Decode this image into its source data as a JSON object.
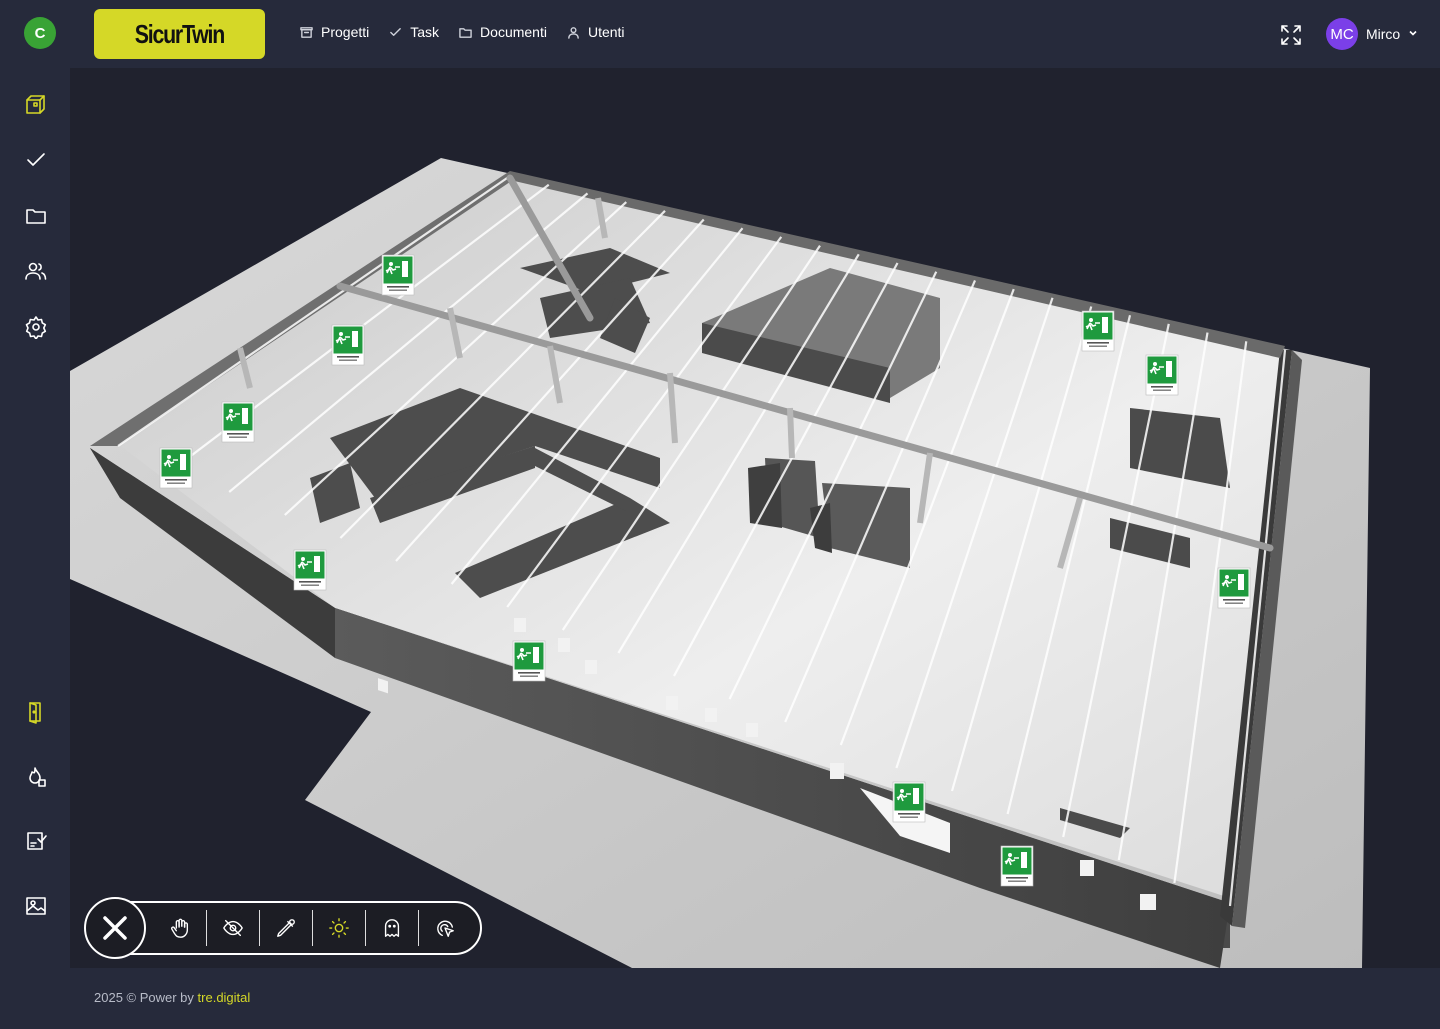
{
  "app": {
    "brand_initial": "C",
    "logo_text": "SicurTwin"
  },
  "nav": {
    "items": [
      {
        "label": "Progetti",
        "icon": "box-icon"
      },
      {
        "label": "Task",
        "icon": "check-icon"
      },
      {
        "label": "Documenti",
        "icon": "folder-icon"
      },
      {
        "label": "Utenti",
        "icon": "user-icon"
      }
    ]
  },
  "user": {
    "initials": "MC",
    "name": "Mirco"
  },
  "sidebar": {
    "icons": [
      "cube-icon",
      "check-icon",
      "folder-icon",
      "users-icon",
      "settings-icon",
      "emergency-door-icon",
      "fire-icon",
      "checklist-icon",
      "image-icon"
    ]
  },
  "viewer": {
    "toolbar": [
      "close-icon",
      "hand-pan-icon",
      "hide-icon",
      "measure-icon",
      "light-icon",
      "ghost-icon",
      "select-icon"
    ]
  },
  "footer": {
    "text": "2025 © Power by ",
    "link": "tre.digital"
  },
  "colors": {
    "accent": "#d5d827",
    "background": "#262a3b",
    "avatar": "#7b3fe8",
    "brand_dot": "#39a335",
    "exit_sign": "#1f9a3e"
  }
}
